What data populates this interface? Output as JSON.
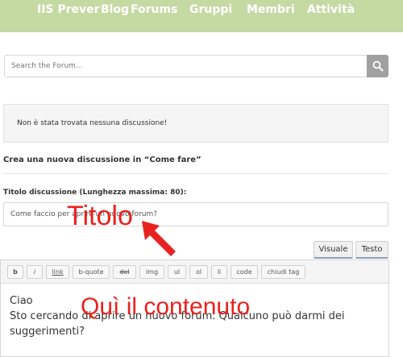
{
  "nav": {
    "items": [
      "IIS Prever",
      "Blog",
      "Forums",
      "Gruppi",
      "Membri",
      "Attività"
    ]
  },
  "search": {
    "placeholder": "Search the Forum..."
  },
  "notice": {
    "text": "Non è stata trovata nessuna discussione!"
  },
  "new_discussion": {
    "heading": "Crea una nuova discussione in “Come fare”",
    "title_label": "Titolo discussione (Lunghezza massima: 80):",
    "title_value": "Come faccio per aprire un nuovo forum?"
  },
  "editor": {
    "modes": [
      "Visuale",
      "Testo"
    ],
    "toolbar": [
      "b",
      "i",
      "link",
      "b-quote",
      "del",
      "img",
      "ul",
      "ol",
      "li",
      "code",
      "chiudi tag"
    ],
    "content_lines": [
      "Ciao",
      "Sto cercando di aprire un nuovo forum. Qualcuno può darmi dei",
      "suggerimenti?"
    ]
  },
  "annotations": {
    "title": "Titolo",
    "content": "Quì il contenuto",
    "color": "#e8221f"
  },
  "colors": {
    "nav_bg": "#c5d9a3",
    "search_button": "#a0a0a0"
  },
  "icons": {
    "search_button": "search-icon",
    "pointer": "arrow-up-left-icon"
  }
}
